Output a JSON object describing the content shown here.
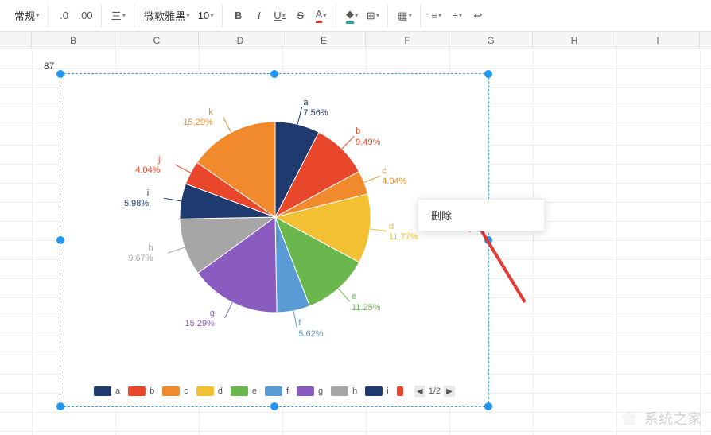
{
  "toolbar": {
    "format_style": "常规",
    "dec_dec": ".0",
    "dec_inc": ".00",
    "font_name": "微软雅黑",
    "font_size": "10"
  },
  "columns": [
    "B",
    "C",
    "D",
    "E",
    "F",
    "G",
    "H",
    "I"
  ],
  "anchor_cell": "87",
  "context_menu": {
    "delete": "删除"
  },
  "legend_nav": {
    "page": "1/2"
  },
  "chart_data": {
    "type": "pie",
    "series": [
      {
        "name": "a",
        "value": 7.56,
        "color": "#1f3a6e"
      },
      {
        "name": "b",
        "value": 9.49,
        "color": "#e8472c"
      },
      {
        "name": "c",
        "value": 4.04,
        "color": "#f08a2c"
      },
      {
        "name": "d",
        "value": 11.77,
        "color": "#f2c032"
      },
      {
        "name": "e",
        "value": 11.25,
        "color": "#6ab84d"
      },
      {
        "name": "f",
        "value": 5.62,
        "color": "#5a9bd5"
      },
      {
        "name": "g",
        "value": 15.29,
        "color": "#8a5cc0"
      },
      {
        "name": "h",
        "value": 9.67,
        "color": "#a6a6a6"
      },
      {
        "name": "i",
        "value": 5.98,
        "color": "#1f3a6e"
      },
      {
        "name": "j",
        "value": 4.04,
        "color": "#e8472c"
      },
      {
        "name": "k",
        "value": 15.29,
        "color": "#f08a2c"
      }
    ],
    "label_format": "{pct}%",
    "legend_position": "bottom"
  },
  "watermark": "系统之家"
}
